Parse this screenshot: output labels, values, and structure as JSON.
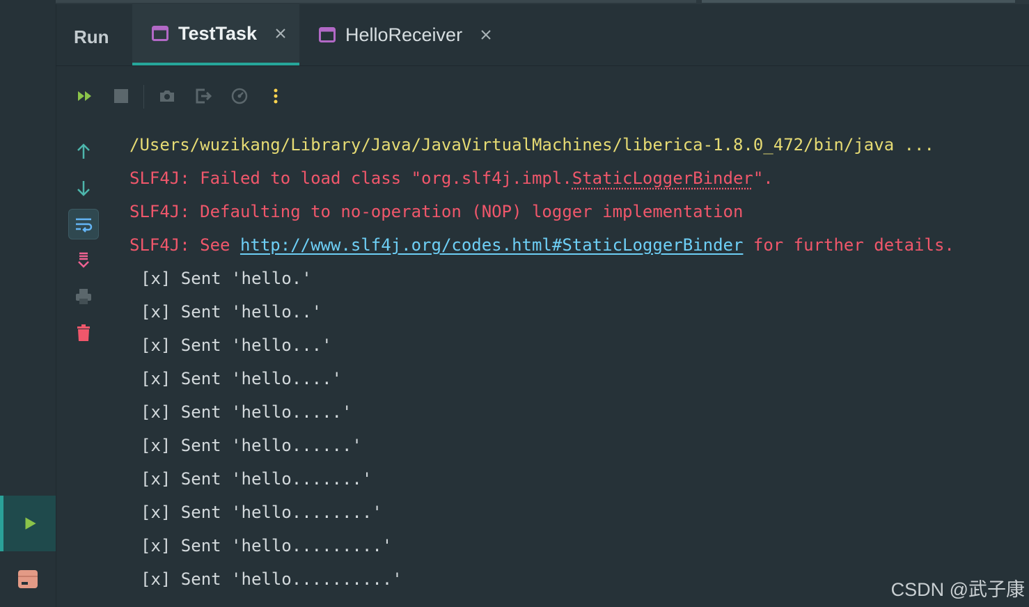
{
  "window": {
    "run_label": "Run",
    "tabs": [
      {
        "title": "TestTask",
        "active": true
      },
      {
        "title": "HelloReceiver",
        "active": false
      }
    ]
  },
  "toolbar": {
    "items": [
      "rerun-icon",
      "stop-icon",
      "camera-icon",
      "exit-icon",
      "gauge-icon",
      "more-icon"
    ]
  },
  "side_tools": [
    "arrow-up-icon",
    "arrow-down-icon",
    "soft-wrap-icon",
    "scroll-to-end-icon",
    "print-icon",
    "trash-icon"
  ],
  "console": {
    "command": "/Users/wuzikang/Library/Java/JavaVirtualMachines/liberica-1.8.0_472/bin/java ...",
    "errors": {
      "line1_prefix": "SLF4J: Failed to load class \"org.slf4j.impl.",
      "line1_class": "StaticLoggerBinder",
      "line1_suffix": "\".",
      "line2": "SLF4J: Defaulting to no-operation (NOP) logger implementation",
      "line3_prefix": "SLF4J: See ",
      "line3_link": "http://www.slf4j.org/codes.html#StaticLoggerBinder",
      "line3_suffix": " for further details."
    },
    "output": [
      "[x] Sent 'hello.'",
      "[x] Sent 'hello..'",
      "[x] Sent 'hello...'",
      "[x] Sent 'hello....'",
      "[x] Sent 'hello.....'",
      "[x] Sent 'hello......'",
      "[x] Sent 'hello.......'",
      "[x] Sent 'hello........'",
      "[x] Sent 'hello.........'",
      "[x] Sent 'hello..........'"
    ]
  },
  "watermark": "CSDN @武子康",
  "colors": {
    "background": "#263238",
    "accent": "#26a69a",
    "path": "#e6db74",
    "error": "#f0576b",
    "link": "#6ecff6"
  }
}
